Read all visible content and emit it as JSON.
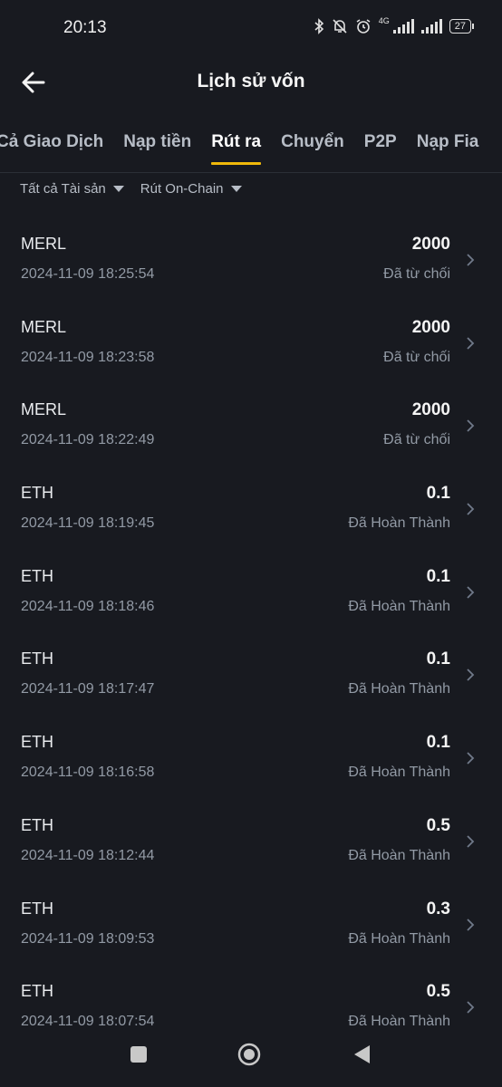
{
  "status_bar": {
    "time": "20:13",
    "network": "4G",
    "battery": "27",
    "icons": [
      "bluetooth-icon",
      "mute-bell-icon",
      "alarm-icon",
      "signal-icon",
      "signal-icon",
      "battery-icon"
    ]
  },
  "header": {
    "title": "Lịch sử vốn"
  },
  "tabs": [
    {
      "label": "Tất cả Giao Dịch",
      "display": "Cả Giao Dịch"
    },
    {
      "label": "Nạp tiền"
    },
    {
      "label": "Rút ra"
    },
    {
      "label": "Chuyển"
    },
    {
      "label": "P2P"
    },
    {
      "label": "Nạp Fia"
    }
  ],
  "filters": {
    "asset": "Tất cả Tài sản",
    "type": "Rút On-Chain"
  },
  "transactions": [
    {
      "asset": "MERL",
      "datetime": "2024-11-09 18:25:54",
      "amount": "2000",
      "status": "Đã từ chối"
    },
    {
      "asset": "MERL",
      "datetime": "2024-11-09 18:23:58",
      "amount": "2000",
      "status": "Đã từ chối"
    },
    {
      "asset": "MERL",
      "datetime": "2024-11-09 18:22:49",
      "amount": "2000",
      "status": "Đã từ chối"
    },
    {
      "asset": "ETH",
      "datetime": "2024-11-09 18:19:45",
      "amount": "0.1",
      "status": "Đã Hoàn Thành"
    },
    {
      "asset": "ETH",
      "datetime": "2024-11-09 18:18:46",
      "amount": "0.1",
      "status": "Đã Hoàn Thành"
    },
    {
      "asset": "ETH",
      "datetime": "2024-11-09 18:17:47",
      "amount": "0.1",
      "status": "Đã Hoàn Thành"
    },
    {
      "asset": "ETH",
      "datetime": "2024-11-09 18:16:58",
      "amount": "0.1",
      "status": "Đã Hoàn Thành"
    },
    {
      "asset": "ETH",
      "datetime": "2024-11-09 18:12:44",
      "amount": "0.5",
      "status": "Đã Hoàn Thành"
    },
    {
      "asset": "ETH",
      "datetime": "2024-11-09 18:09:53",
      "amount": "0.3",
      "status": "Đã Hoàn Thành"
    },
    {
      "asset": "ETH",
      "datetime": "2024-11-09 18:07:54",
      "amount": "0.5",
      "status": "Đã Hoàn Thành"
    }
  ],
  "colors": {
    "background": "#181a20",
    "accent": "#f0b90b",
    "text_primary": "#eaecef",
    "text_secondary": "#929aa5"
  }
}
